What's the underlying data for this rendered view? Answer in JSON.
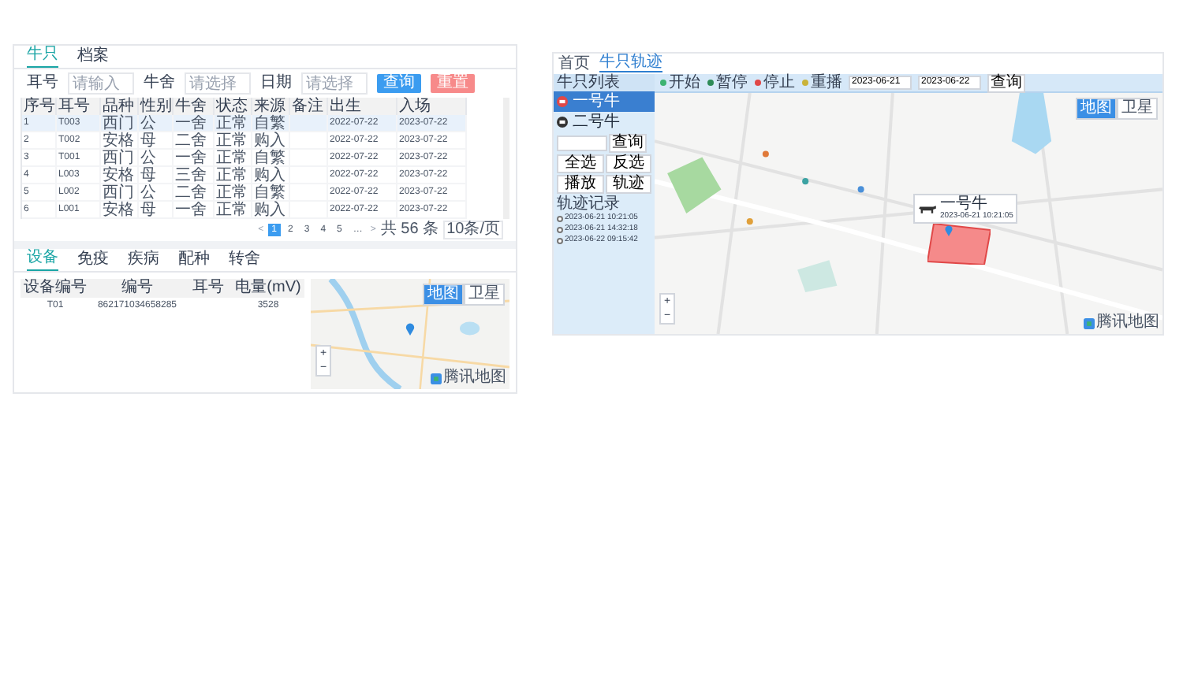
{
  "left_panel": {
    "tabs": [
      {
        "label": "牛只",
        "selected": true
      },
      {
        "label": "档案",
        "selected": false
      }
    ],
    "filters": [
      {
        "label": "耳号",
        "placeholder": "请输入"
      },
      {
        "label": "牛舍",
        "placeholder": "请选择"
      },
      {
        "label": "日期",
        "placeholder": "请选择"
      }
    ],
    "buttons": [
      {
        "label": "查询",
        "kind": "primary"
      },
      {
        "label": "重置",
        "kind": "danger"
      }
    ],
    "table": {
      "columns": [
        "序号",
        "耳号",
        "品种",
        "性别",
        "牛舍",
        "状态",
        "来源",
        "备注",
        "出生",
        "入场"
      ],
      "rows": [
        {
          "selected": true,
          "cells": [
            "1",
            "T003",
            "西门",
            "公",
            "一舍",
            "正常",
            "自繁",
            null,
            "2022-07-22",
            "2023-07-22"
          ]
        },
        {
          "selected": false,
          "cells": [
            "2",
            "T002",
            "安格",
            "母",
            "二舍",
            "正常",
            "购入",
            null,
            "2022-07-22",
            "2023-07-22"
          ]
        },
        {
          "selected": false,
          "cells": [
            "3",
            "T001",
            "西门",
            "公",
            "一舍",
            "正常",
            "自繁",
            null,
            "2022-07-22",
            "2023-07-22"
          ]
        },
        {
          "selected": false,
          "cells": [
            "4",
            "L003",
            "安格",
            "母",
            "三舍",
            "正常",
            "购入",
            null,
            "2022-07-22",
            "2023-07-22"
          ]
        },
        {
          "selected": false,
          "cells": [
            "5",
            "L002",
            "西门",
            "公",
            "二舍",
            "正常",
            "自繁",
            null,
            "2022-07-22",
            "2023-07-22"
          ]
        },
        {
          "selected": false,
          "cells": [
            "6",
            "L001",
            "安格",
            "母",
            "一舍",
            "正常",
            "购入",
            null,
            "2022-07-22",
            "2023-07-22"
          ]
        }
      ]
    },
    "pagination": {
      "prev": "<",
      "pages": [
        {
          "label": "1",
          "selected": true
        },
        {
          "label": "2",
          "selected": false
        },
        {
          "label": "3",
          "selected": false
        },
        {
          "label": "4",
          "selected": false
        },
        {
          "label": "5",
          "selected": false
        },
        {
          "label": "…",
          "selected": false
        }
      ],
      "next": ">",
      "total": "共 56 条",
      "page_size": "10条/页"
    },
    "detail_tabs": [
      {
        "label": "设备",
        "selected": true
      },
      {
        "label": "免疫",
        "selected": false
      },
      {
        "label": "疾病",
        "selected": false
      },
      {
        "label": "配种",
        "selected": false
      },
      {
        "label": "转舍",
        "selected": false
      }
    ],
    "device_table": {
      "columns": [
        "设备编号",
        "编号",
        "耳号",
        "电量(mV)"
      ],
      "rows": [
        {
          "cells": [
            "T01",
            "862171034658285",
            null,
            "3528"
          ]
        }
      ]
    },
    "map": {
      "modes": [
        {
          "label": "地图",
          "selected": true
        },
        {
          "label": "卫星",
          "selected": false
        }
      ],
      "zoom": [
        "+",
        "−"
      ],
      "logo": "腾讯地图"
    }
  },
  "right_panel": {
    "breadcrumb": [
      {
        "label": "首页",
        "selected": false
      },
      {
        "label": "牛只轨迹",
        "selected": true
      }
    ],
    "sidebar": {
      "title": "牛只列表",
      "items": [
        {
          "label": "一号牛",
          "selected": true
        },
        {
          "label": "二号牛",
          "selected": false
        }
      ],
      "search_button": "查询",
      "actions": [
        "全选",
        "反选",
        "播放",
        "轨迹"
      ],
      "records_title": "轨迹记录",
      "records": [
        {
          "label": "2023-06-21 10:21:05",
          "checked": false
        },
        {
          "label": "2023-06-21 14:32:18",
          "checked": false
        },
        {
          "label": "2023-06-22 09:15:42",
          "checked": false
        }
      ]
    },
    "toolbar": {
      "buttons": [
        {
          "label": "开始"
        },
        {
          "label": "暂停"
        },
        {
          "label": "停止"
        },
        {
          "label": "重播"
        }
      ],
      "start_date": "2023-06-21",
      "end_date": "2023-06-22",
      "search": "查询"
    },
    "map": {
      "modes": [
        {
          "label": "地图",
          "selected": true
        },
        {
          "label": "卫星",
          "selected": false
        }
      ],
      "popup": {
        "name": "一号牛",
        "time": "2023-06-21 10:21:05"
      },
      "zoom": [
        "+",
        "−"
      ],
      "logo": "腾讯地图"
    }
  }
}
